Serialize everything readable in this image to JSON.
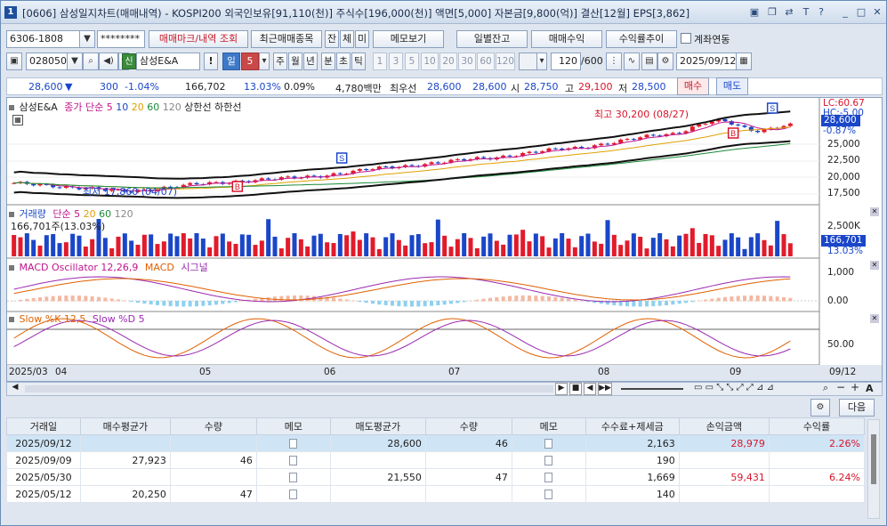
{
  "title": {
    "icon": "1",
    "text": "[0606] 삼성일지차트(매매내역) - KOSPI200 외국인보유[91,110(천)] 주식수[196,000(천)] 액면[5,000] 자본금[9,800(억)] 결산[12월] EPS[3,862]"
  },
  "toolbar1": {
    "account": "6306-1808",
    "password": "********",
    "mark_btn": "매매마크/내역 조회",
    "recent_btn": "최근매매종목",
    "jan": "잔",
    "che": "체",
    "mi": "미",
    "memo_btn": "메모보기",
    "daily_btn": "일별잔고",
    "profit_btn": "매매수익",
    "trend_btn": "수익률추이",
    "link_label": "계좌연동"
  },
  "toolbar2": {
    "code": "028050",
    "credit_tag": "신",
    "stock_name": "삼성E&A",
    "excl": "!",
    "period_sel": "일",
    "period_num": "5",
    "periods": [
      "주",
      "월",
      "년",
      "분",
      "초",
      "틱"
    ],
    "nums": [
      "1",
      "3",
      "5",
      "10",
      "20",
      "30",
      "60",
      "120"
    ],
    "count": "120",
    "total": "/600",
    "date": "2025/09/12"
  },
  "quote": {
    "price": "28,600",
    "change": "300",
    "rate": "-1.04%",
    "volume": "166,702",
    "vol_rate": "13.03%",
    "turnover": "0.09%",
    "amount": "4,780백만",
    "best_label": "최우선",
    "ask": "28,600",
    "bid": "28,600",
    "open_label": "시",
    "open": "28,750",
    "high_label": "고",
    "high": "29,100",
    "low_label": "저",
    "low": "28,500",
    "buy": "매수",
    "sell": "매도"
  },
  "chart_data": {
    "type": "candlestick",
    "stock": "삼성E&A",
    "price_legend": [
      "종가 단순 5",
      "10",
      "20",
      "60",
      "120",
      "상한선",
      "하한선"
    ],
    "price_ticks": [
      "25,000",
      "22,500",
      "20,000",
      "17,500"
    ],
    "price_axis": {
      "min": 16000,
      "max": 31500
    },
    "current_price": "28,600",
    "lc_label": "LC:60.67",
    "hc_label": "HC:-5.00",
    "change_label": "-0.87%",
    "high_annotation": "최고 30,200 (08/27)",
    "low_annotation": "최저 17,860 (04/07)",
    "volume_legend": [
      "거래량",
      "단순 5",
      "20",
      "60",
      "120"
    ],
    "volume_value": "166,701주(13.03%)",
    "volume_ticks": [
      "2,500K"
    ],
    "volume_current": "166,701",
    "volume_rate": "13.03%",
    "macd_legend": "MACD Oscillator 12,26,9",
    "macd_label": "MACD",
    "signal_label": "시그널",
    "macd_ticks": [
      "1,000",
      "0.00"
    ],
    "slow_legend": "Slow %K 12,5",
    "slowd_legend": "Slow %D 5",
    "slow_ticks": [
      "50.00"
    ],
    "x_labels": [
      "2025/03",
      "04",
      "05",
      "06",
      "07",
      "08",
      "09",
      "09/12"
    ],
    "marks": [
      "S",
      "B",
      "S",
      "B"
    ]
  },
  "bottom_toolbar": {
    "next_btn": "다음"
  },
  "grid": {
    "headers": [
      "거래일",
      "매수평균가",
      "수량",
      "메모",
      "매도평균가",
      "수량",
      "메모",
      "수수료+제세금",
      "손익금액",
      "수익률"
    ],
    "rows": [
      [
        "2025/09/12",
        "",
        "",
        "",
        "28,600",
        "46",
        "",
        "2,163",
        "28,979",
        "2.26%"
      ],
      [
        "2025/09/09",
        "27,923",
        "46",
        "",
        "",
        "",
        "",
        "190",
        "",
        ""
      ],
      [
        "2025/05/30",
        "",
        "",
        "",
        "21,550",
        "47",
        "",
        "1,669",
        "59,431",
        "6.24%"
      ],
      [
        "2025/05/12",
        "20,250",
        "47",
        "",
        "",
        "",
        "",
        "140",
        "",
        ""
      ]
    ]
  }
}
